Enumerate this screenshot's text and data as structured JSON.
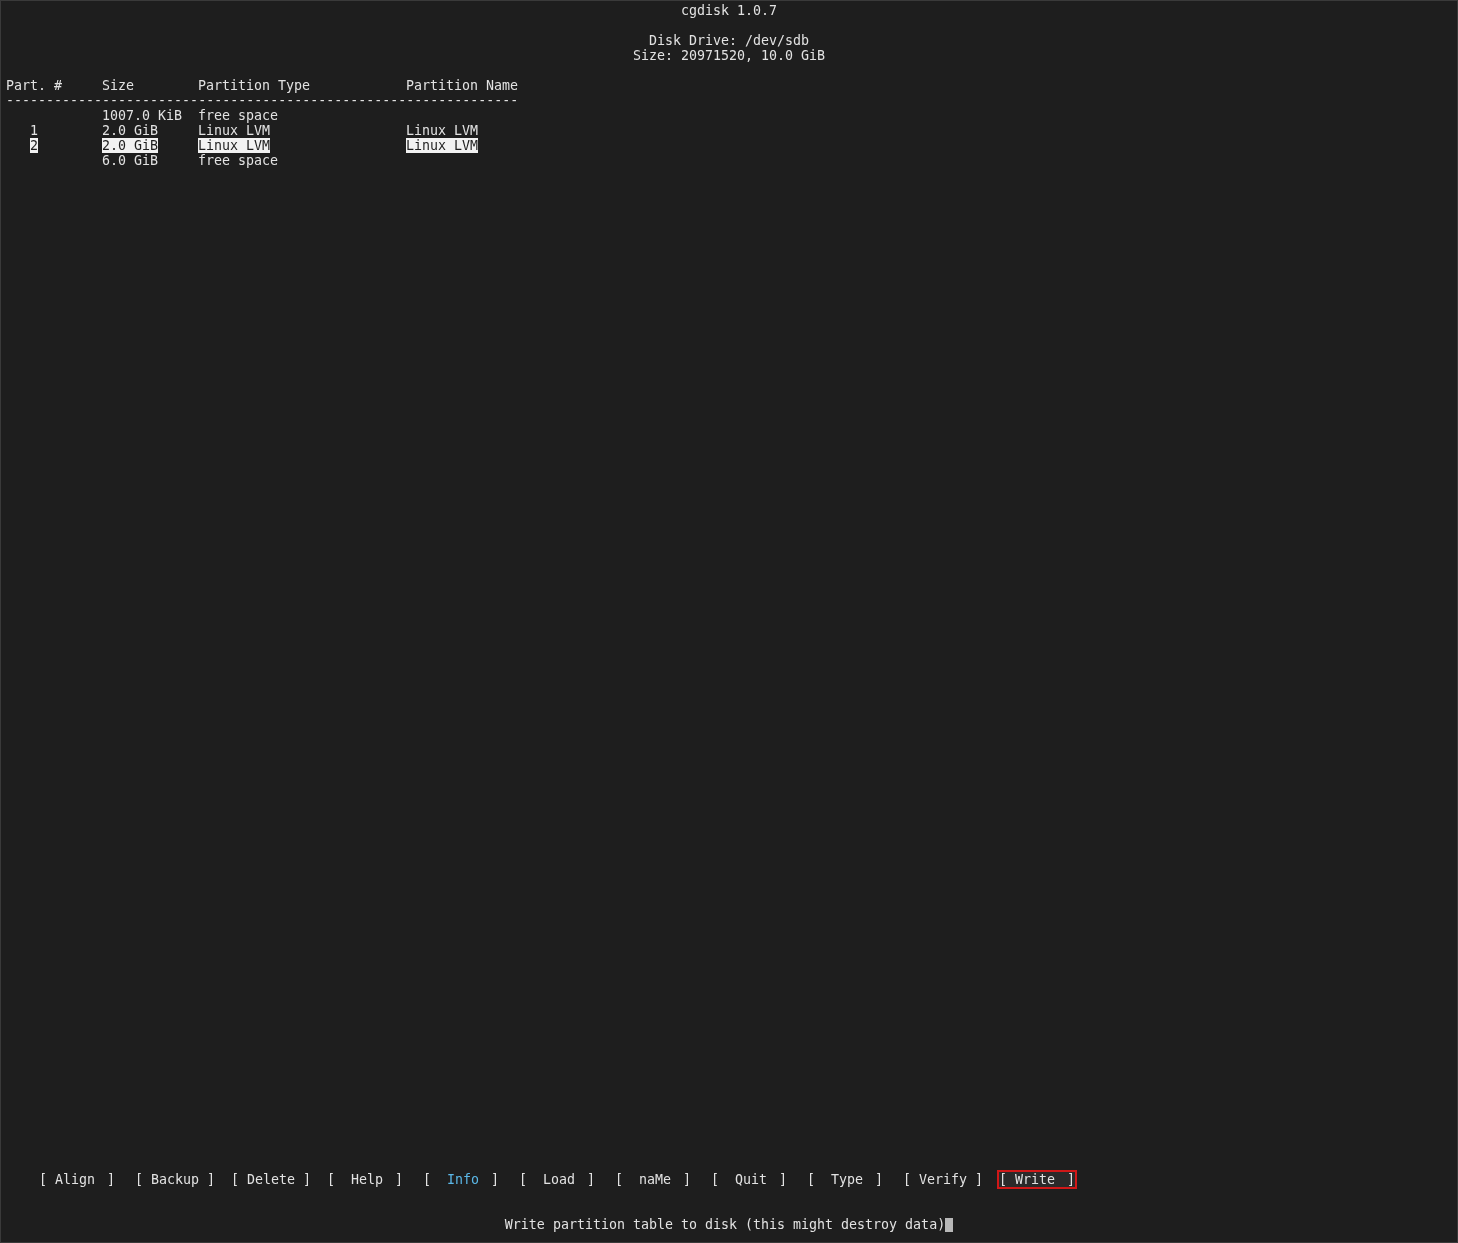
{
  "header": {
    "title": "cgdisk 1.0.7",
    "drive": "Disk Drive: /dev/sdb",
    "size": "Size: 20971520, 10.0 GiB"
  },
  "table": {
    "columns": [
      "Part. #",
      "Size",
      "Partition Type",
      "Partition Name"
    ],
    "rule": "----------------------------------------------------------------",
    "rows": [
      {
        "size": "1007.0 KiB",
        "type": "free space",
        "selected": false
      },
      {
        "number": "1",
        "size": "2.0 GiB",
        "type": "Linux LVM",
        "name": "Linux LVM",
        "selected": false
      },
      {
        "number": "2",
        "size": "2.0 GiB",
        "type": "Linux LVM",
        "name": "Linux LVM",
        "selected": true
      },
      {
        "size": "6.0 GiB",
        "type": "free space",
        "selected": false
      }
    ]
  },
  "menu": [
    {
      "open": "[",
      "label": "Align",
      "close": "]",
      "highlighted": false,
      "selected": false
    },
    {
      "open": "[",
      "label": "Backup",
      "close": "]",
      "highlighted": false,
      "selected": false
    },
    {
      "open": "[",
      "label": "Delete",
      "close": "]",
      "highlighted": false,
      "selected": false
    },
    {
      "open": "[",
      "label": "Help",
      "close": "]",
      "highlighted": false,
      "selected": false
    },
    {
      "open": "[",
      "label": "Info",
      "close": "]",
      "highlighted": true,
      "selected": false
    },
    {
      "open": "[",
      "label": "Load",
      "close": "]",
      "highlighted": false,
      "selected": false
    },
    {
      "open": "[",
      "label": "naMe",
      "close": "]",
      "highlighted": false,
      "selected": false
    },
    {
      "open": "[",
      "label": "Quit",
      "close": "]",
      "highlighted": false,
      "selected": false
    },
    {
      "open": "[",
      "label": "Type",
      "close": "]",
      "highlighted": false,
      "selected": false
    },
    {
      "open": "[",
      "label": "Verify",
      "close": "]",
      "highlighted": false,
      "selected": false
    },
    {
      "open": "[",
      "label": "Write",
      "close": "]",
      "highlighted": false,
      "selected": true
    }
  ],
  "status": "Write partition table to disk (this might destroy data)"
}
